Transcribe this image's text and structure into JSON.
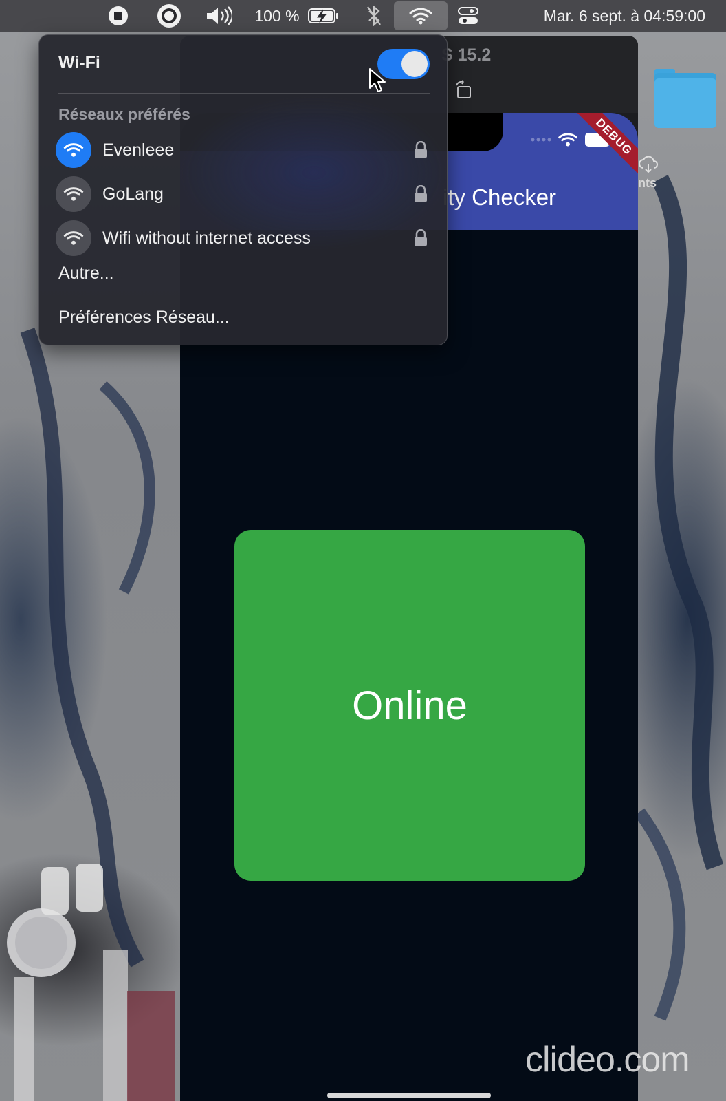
{
  "menubar": {
    "battery": "100 %",
    "datetime": "Mar. 6 sept. à  04:59:00",
    "icons": [
      "stop-icon",
      "record-icon",
      "volume-icon",
      "battery-charging-icon",
      "bluetooth-off-icon",
      "wifi-icon",
      "control-center-icon"
    ]
  },
  "simulator": {
    "title": "S 15.2",
    "app_title": "ity Checker",
    "debug_banner": "DEBUG",
    "status_text": "Online",
    "status_color": "#36a744",
    "appbar_color": "#3a49a8"
  },
  "desktop": {
    "folder_label": "nts"
  },
  "wifi_menu": {
    "header": "Wi-Fi",
    "enabled": true,
    "section_label": "Réseaux préférés",
    "networks": [
      {
        "name": "Evenleee",
        "connected": true,
        "locked": true
      },
      {
        "name": "GoLang",
        "connected": false,
        "locked": true
      },
      {
        "name": "Wifi without internet access",
        "connected": false,
        "locked": true
      }
    ],
    "other_label": "Autre...",
    "preferences_label": "Préférences Réseau...",
    "accent": "#1f7cf5"
  },
  "watermark": "clideo.com"
}
